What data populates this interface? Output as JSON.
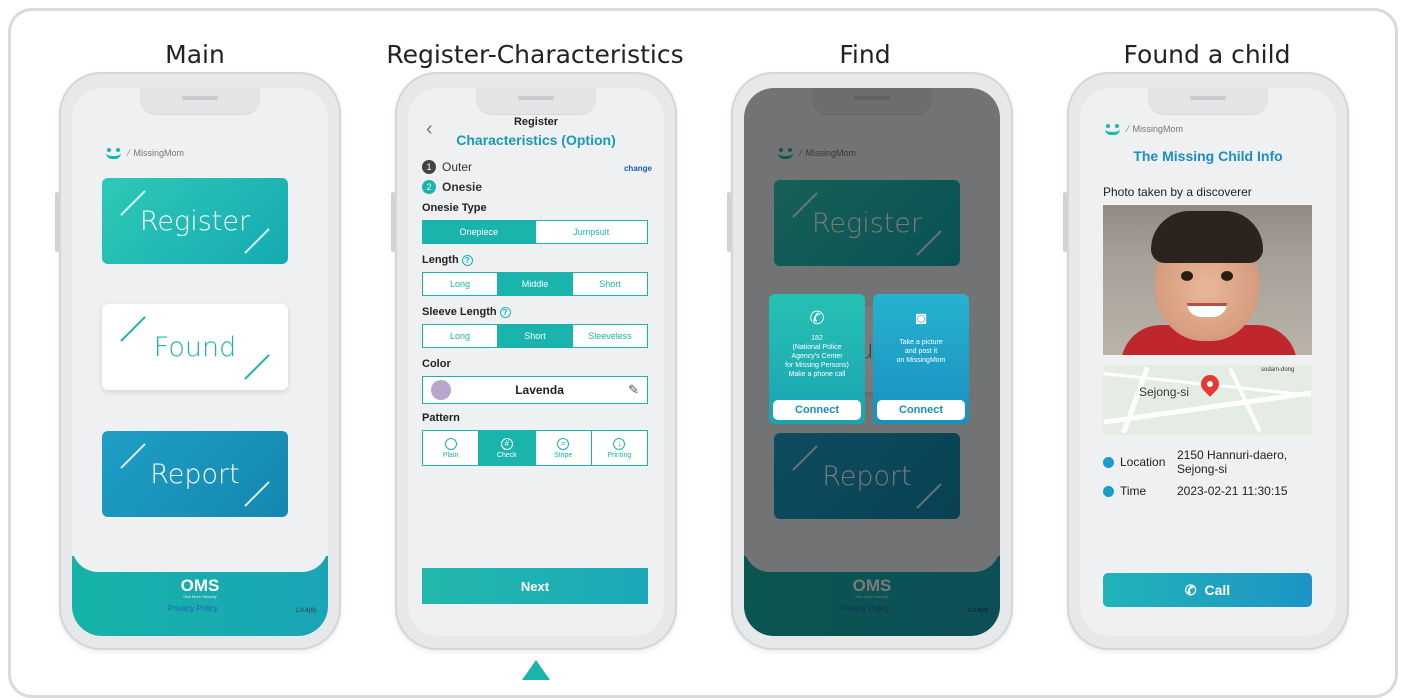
{
  "panels": {
    "main": "Main",
    "register": "Register-Characteristics",
    "find": "Find",
    "found": "Found a child"
  },
  "app": {
    "logo_text": "MissingMom",
    "footer_brand": "OMS",
    "footer_sub": "One More Security",
    "privacy": "Privacy Policy",
    "version": "1.0.4(9)"
  },
  "main_cards": {
    "register": "Register",
    "found": "Found",
    "report": "Report"
  },
  "register_screen": {
    "subtitle": "Register",
    "title": "Characteristics (Option)",
    "steps": [
      {
        "num": "1",
        "label": "Outer"
      },
      {
        "num": "2",
        "label": "Onesie"
      }
    ],
    "change": "change",
    "onesie_type_label": "Onesie Type",
    "onesie_types": [
      "Onepiece",
      "Jumpsuit"
    ],
    "length_label": "Length",
    "lengths": [
      "Long",
      "Middle",
      "Short"
    ],
    "sleeve_label": "Sleeve Length",
    "sleeves": [
      "Long",
      "Short",
      "Sleeveless"
    ],
    "color_label": "Color",
    "color_value": "Lavenda",
    "pattern_label": "Pattern",
    "patterns": [
      "Plain",
      "Check",
      "Stripe",
      "Printing"
    ],
    "next": "Next"
  },
  "find_screen": {
    "call_text": "182\n(National Police Agency's Center for Missing Persons)\nMake a phone call",
    "call_line1": "182",
    "call_line2": "(National Police",
    "call_line3": "Agency's Center",
    "call_line4": "for Missing Persons)",
    "call_line5": "Make a phone call",
    "picture_line1": "Take a picture",
    "picture_line2": "and post it",
    "picture_line3": "on MissingMom",
    "connect": "Connect"
  },
  "found_screen": {
    "title": "The Missing Child Info",
    "photo_caption": "Photo taken by a discoverer",
    "map_city": "Sejong-si",
    "map_area": "sodam-dong",
    "location_label": "Location",
    "location_value_1": "2150 Hannuri-daero,",
    "location_value_2": "Sejong-si",
    "time_label": "Time",
    "time_value": "2023-02-21 11:30:15",
    "call": "Call"
  }
}
